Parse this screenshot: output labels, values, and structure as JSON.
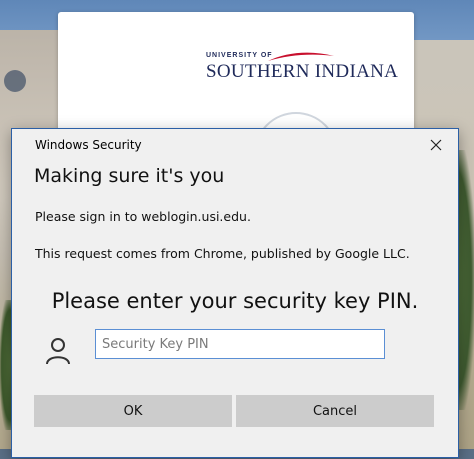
{
  "background": {
    "login_card": {
      "logo_top_text": "UNIVERSITY OF",
      "logo_main_text": "SOUTHERN INDIANA",
      "logo_color": "#1f2a5a",
      "swoosh_color": "#c8102e"
    }
  },
  "dialog": {
    "window_title": "Windows Security",
    "heading": "Making sure it's you",
    "signin_text": "Please sign in to weblogin.usi.edu.",
    "request_text": "This request comes from Chrome, published by Google LLC.",
    "prompt": "Please enter your security key PIN.",
    "pin_field": {
      "value": "",
      "placeholder": "Security Key PIN"
    },
    "ok_label": "OK",
    "cancel_label": "Cancel",
    "close_icon": "close-icon",
    "user_icon": "person-icon",
    "border_color": "#2b5fa6",
    "input_border_color": "#5b8fd4"
  }
}
